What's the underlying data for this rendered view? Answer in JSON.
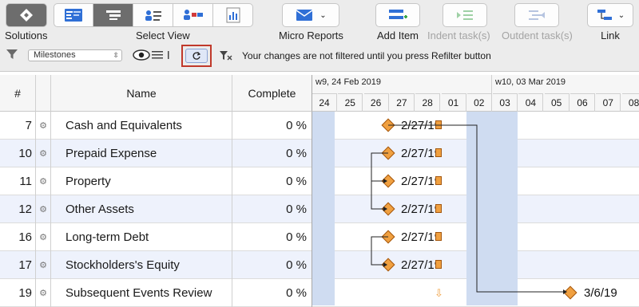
{
  "toolbar": {
    "solutions_label": "Solutions",
    "select_view_label": "Select View",
    "micro_reports_label": "Micro Reports",
    "add_item_label": "Add Item",
    "indent_label": "Indent task(s)",
    "outdent_label": "Outdent task(s)",
    "link_label": "Link"
  },
  "filter": {
    "selected": "Milestones",
    "message": "Your changes are not filtered until you press Refilter button"
  },
  "table": {
    "col_num": "#",
    "col_name": "Name",
    "col_complete": "Complete",
    "rows": [
      {
        "num": "7",
        "name": "Cash and Equivalents",
        "complete": "0 %"
      },
      {
        "num": "10",
        "name": "Prepaid Expense",
        "complete": "0 %"
      },
      {
        "num": "11",
        "name": "Property",
        "complete": "0 %"
      },
      {
        "num": "12",
        "name": "Other Assets",
        "complete": "0 %"
      },
      {
        "num": "16",
        "name": "Long-term Debt",
        "complete": "0 %"
      },
      {
        "num": "17",
        "name": "Stockholders's Equity",
        "complete": "0 %"
      },
      {
        "num": "19",
        "name": "Subsequent Events Review",
        "complete": "0 %"
      }
    ]
  },
  "gantt": {
    "week1": "w9, 24 Feb 2019",
    "week2": "w10, 03 Mar 2019",
    "days": [
      "24",
      "25",
      "26",
      "27",
      "28",
      "01",
      "02",
      "03",
      "04",
      "05",
      "06",
      "07",
      "08"
    ],
    "milestone_labels": [
      "2/27/19",
      "2/27/19",
      "2/27/19",
      "2/27/19",
      "2/27/19",
      "2/27/19",
      "3/6/19"
    ]
  },
  "colors": {
    "accent": "#3a6fd8",
    "milestone": "#f0a040",
    "weekend": "#cfdcf1"
  }
}
